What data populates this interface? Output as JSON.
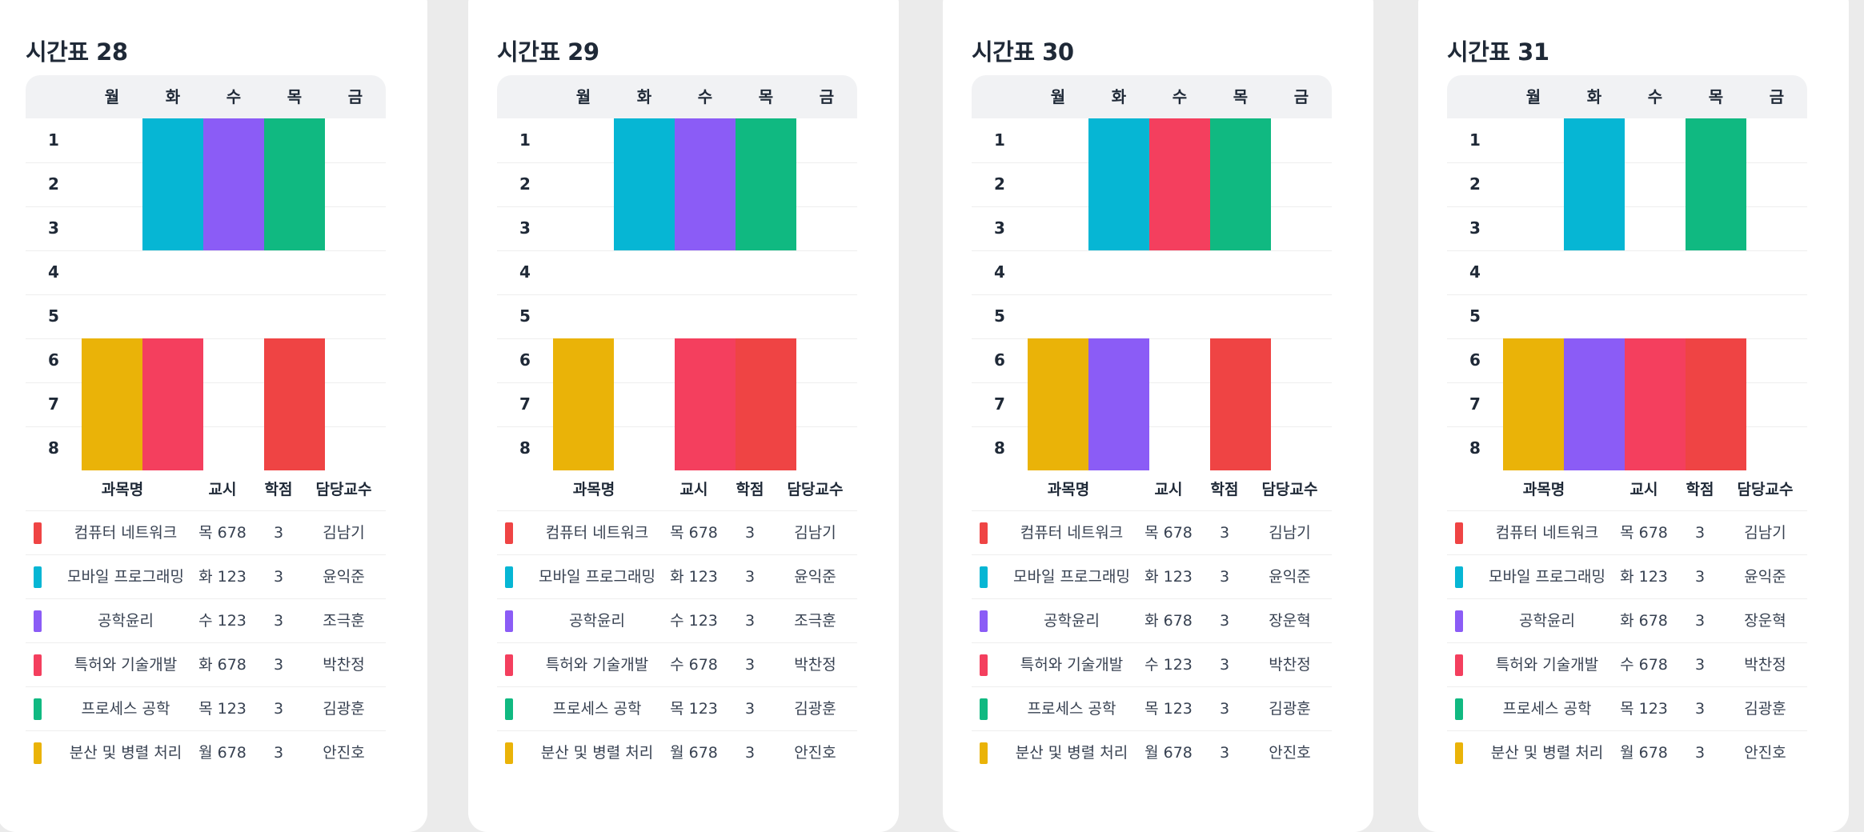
{
  "colors": {
    "컴퓨터 네트워크": "#ef4444",
    "모바일 프로그래밍": "#06b6d4",
    "공학윤리": "#8b5cf6",
    "특허와 기술개발": "#f43f5e",
    "프로세스 공학": "#10b981",
    "분산 및 병렬 처리": "#eab308"
  },
  "days": [
    "월",
    "화",
    "수",
    "목",
    "금"
  ],
  "periods": [
    "1",
    "2",
    "3",
    "4",
    "5",
    "6",
    "7",
    "8"
  ],
  "table_headers": [
    "과목명",
    "교시",
    "학점",
    "담당교수"
  ],
  "timetables": [
    {
      "title": "시간표 28",
      "courses": [
        {
          "name": "컴퓨터 네트워크",
          "time": "목 678",
          "credit": "3",
          "prof": "김남기"
        },
        {
          "name": "모바일 프로그래밍",
          "time": "화 123",
          "credit": "3",
          "prof": "윤익준"
        },
        {
          "name": "공학윤리",
          "time": "수 123",
          "credit": "3",
          "prof": "조극훈"
        },
        {
          "name": "특허와 기술개발",
          "time": "화 678",
          "credit": "3",
          "prof": "박찬정"
        },
        {
          "name": "프로세스 공학",
          "time": "목 123",
          "credit": "3",
          "prof": "김광훈"
        },
        {
          "name": "분산 및 병렬 처리",
          "time": "월 678",
          "credit": "3",
          "prof": "안진호"
        }
      ]
    },
    {
      "title": "시간표 29",
      "courses": [
        {
          "name": "컴퓨터 네트워크",
          "time": "목 678",
          "credit": "3",
          "prof": "김남기"
        },
        {
          "name": "모바일 프로그래밍",
          "time": "화 123",
          "credit": "3",
          "prof": "윤익준"
        },
        {
          "name": "공학윤리",
          "time": "수 123",
          "credit": "3",
          "prof": "조극훈"
        },
        {
          "name": "특허와 기술개발",
          "time": "수 678",
          "credit": "3",
          "prof": "박찬정"
        },
        {
          "name": "프로세스 공학",
          "time": "목 123",
          "credit": "3",
          "prof": "김광훈"
        },
        {
          "name": "분산 및 병렬 처리",
          "time": "월 678",
          "credit": "3",
          "prof": "안진호"
        }
      ]
    },
    {
      "title": "시간표 30",
      "courses": [
        {
          "name": "컴퓨터 네트워크",
          "time": "목 678",
          "credit": "3",
          "prof": "김남기"
        },
        {
          "name": "모바일 프로그래밍",
          "time": "화 123",
          "credit": "3",
          "prof": "윤익준"
        },
        {
          "name": "공학윤리",
          "time": "화 678",
          "credit": "3",
          "prof": "장운혁"
        },
        {
          "name": "특허와 기술개발",
          "time": "수 123",
          "credit": "3",
          "prof": "박찬정"
        },
        {
          "name": "프로세스 공학",
          "time": "목 123",
          "credit": "3",
          "prof": "김광훈"
        },
        {
          "name": "분산 및 병렬 처리",
          "time": "월 678",
          "credit": "3",
          "prof": "안진호"
        }
      ]
    },
    {
      "title": "시간표 31",
      "courses": [
        {
          "name": "컴퓨터 네트워크",
          "time": "목 678",
          "credit": "3",
          "prof": "김남기"
        },
        {
          "name": "모바일 프로그래밍",
          "time": "화 123",
          "credit": "3",
          "prof": "윤익준"
        },
        {
          "name": "공학윤리",
          "time": "화 678",
          "credit": "3",
          "prof": "장운혁"
        },
        {
          "name": "특허와 기술개발",
          "time": "수 678",
          "credit": "3",
          "prof": "박찬정"
        },
        {
          "name": "프로세스 공학",
          "time": "목 123",
          "credit": "3",
          "prof": "김광훈"
        },
        {
          "name": "분산 및 병렬 처리",
          "time": "월 678",
          "credit": "3",
          "prof": "안진호"
        }
      ]
    }
  ]
}
